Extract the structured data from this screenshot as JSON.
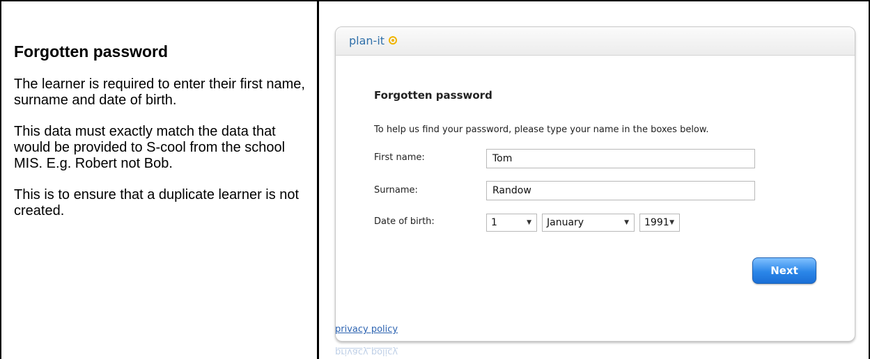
{
  "left_panel": {
    "title": "Forgotten password",
    "paragraphs": [
      "The learner is required to enter their first name, surname and date of birth.",
      "This data must exactly match the data that would be provided to S-cool from the school MIS. E.g. Robert not Bob.",
      "This is to ensure that a duplicate learner is not created."
    ]
  },
  "app": {
    "logo": "plan-it",
    "form_title": "Forgotten password",
    "instructions": "To help us find your password, please type your name in the boxes below.",
    "fields": {
      "first_name": {
        "label": "First name:",
        "value": "Tom"
      },
      "surname": {
        "label": "Surname:",
        "value": "Randow"
      },
      "dob": {
        "label": "Date of birth:",
        "day": "1",
        "month": "January",
        "year": "1991"
      }
    },
    "next_label": "Next",
    "privacy_link": "privacy policy",
    "colors": {
      "accent": "#2b86e8",
      "link": "#2b62b0",
      "logo": "#2f6fa9",
      "logo_mark": "#f0b400"
    }
  }
}
